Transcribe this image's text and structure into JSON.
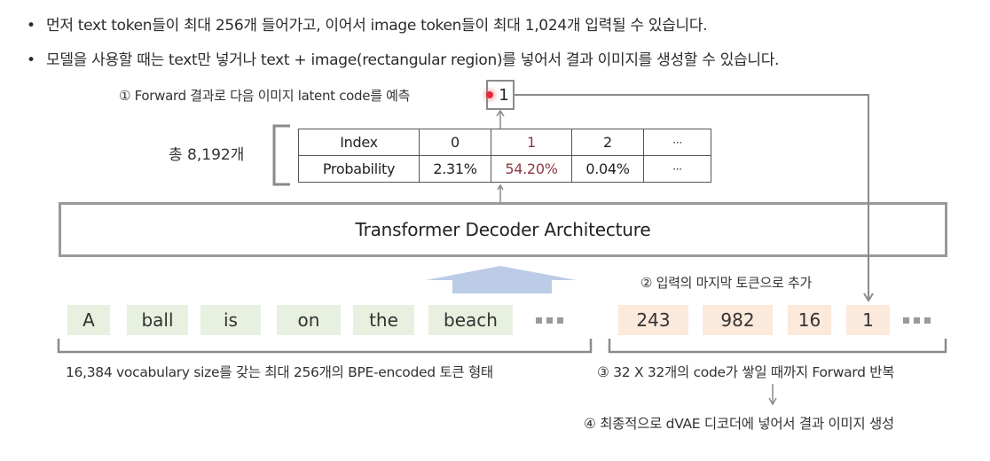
{
  "bullets": [
    "먼저 text token들이 최대 256개 들어가고, 이어서 image token들이 최대 1,024개 입력될 수 있습니다.",
    "모델을 사용할 때는 text만 넣거나 text + image(rectangular region)를 넣어서 결과 이미지를 생성할 수 있습니다."
  ],
  "bullet_symbol": "•",
  "steps": {
    "step1": "① Forward 결과로 다음 이미지 latent code를 예측",
    "step2": "② 입력의 마지막 토큰으로 추가",
    "step3": "③ 32 X 32개의 code가 쌓일 때까지 Forward 반복",
    "step4": "④ 최종적으로 dVAE 디코더에 넣어서 결과 이미지 생성"
  },
  "predicted_code": "1",
  "total_label": "총 8,192개",
  "probability_table": {
    "row_headers": [
      "Index",
      "Probability"
    ],
    "columns": [
      {
        "index": "0",
        "probability": "2.31%",
        "highlight": false
      },
      {
        "index": "1",
        "probability": "54.20%",
        "highlight": true
      },
      {
        "index": "2",
        "probability": "0.04%",
        "highlight": false
      },
      {
        "index": "···",
        "probability": "···",
        "highlight": false
      }
    ]
  },
  "transformer_label": "Transformer Decoder Architecture",
  "text_tokens": [
    "A",
    "ball",
    "is",
    "on",
    "the",
    "beach"
  ],
  "image_tokens": [
    "243",
    "982",
    "16",
    "1"
  ],
  "text_caption": "16,384 vocabulary size를 갖는 최대 256개의 BPE-encoded 토큰 형태",
  "colors": {
    "text_token_bg": "#e8f1e0",
    "image_token_bg": "#fbe9dc",
    "highlight_text": "#8b3a42",
    "input_arrow": "#bccbe6",
    "cursor": "#e02a3a"
  }
}
